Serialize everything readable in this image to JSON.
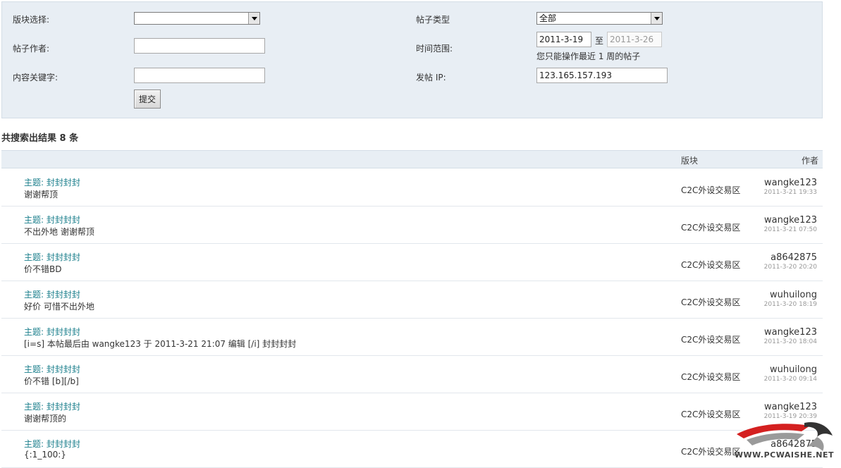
{
  "form": {
    "forum_label": "版块选择:",
    "forum_value": "",
    "type_label": "帖子类型",
    "type_value": "全部",
    "author_label": "帖子作者:",
    "author_value": "",
    "time_label": "时间范围:",
    "time_from": "2011-3-19",
    "time_sep": "至",
    "time_to": "2011-3-26",
    "time_note": "您只能操作最近 1 周的帖子",
    "keyword_label": "内容关键字:",
    "keyword_value": "",
    "ip_label": "发帖 IP:",
    "ip_value": "123.165.157.193",
    "submit_label": "提交"
  },
  "results": {
    "count_text": "共搜索出结果 8 条",
    "col_forum": "版块",
    "col_author": "作者",
    "rows": [
      {
        "subject": "主题: 封封封封",
        "content": "谢谢帮顶",
        "forum": "C2C外设交易区",
        "author": "wangke123",
        "date": "2011-3-21 19:33"
      },
      {
        "subject": "主题: 封封封封",
        "content": "不出外地 谢谢帮顶",
        "forum": "C2C外设交易区",
        "author": "wangke123",
        "date": "2011-3-21 07:50"
      },
      {
        "subject": "主题: 封封封封",
        "content": "价不错BD",
        "forum": "C2C外设交易区",
        "author": "a8642875",
        "date": "2011-3-20 20:20"
      },
      {
        "subject": "主题: 封封封封",
        "content": "好价 可惜不出外地",
        "forum": "C2C外设交易区",
        "author": "wuhuilong",
        "date": "2011-3-20 18:19"
      },
      {
        "subject": "主题: 封封封封",
        "content": "[i=s] 本帖最后由 wangke123 于 2011-3-21 21:07 编辑 [/i] 封封封封",
        "forum": "C2C外设交易区",
        "author": "wangke123",
        "date": "2011-3-20 18:04"
      },
      {
        "subject": "主题: 封封封封",
        "content": "价不错 [b][/b]",
        "forum": "C2C外设交易区",
        "author": "wuhuilong",
        "date": "2011-3-20 09:14"
      },
      {
        "subject": "主题: 封封封封",
        "content": "谢谢帮顶的",
        "forum": "C2C外设交易区",
        "author": "wangke123",
        "date": "2011-3-19 20:39"
      },
      {
        "subject": "主题: 封封封封",
        "content": "{:1_100:}",
        "forum": "C2C外设交易区",
        "author": "a8642875",
        "date": ""
      }
    ]
  },
  "watermark": {
    "text": "WWW.PCWAISHE.NET",
    "colors": {
      "red": "#d42020",
      "gray": "#9a9a9a",
      "dark": "#333333"
    }
  },
  "colors": {
    "panel_bg": "#e8eef4",
    "link": "#1b7f8c"
  }
}
